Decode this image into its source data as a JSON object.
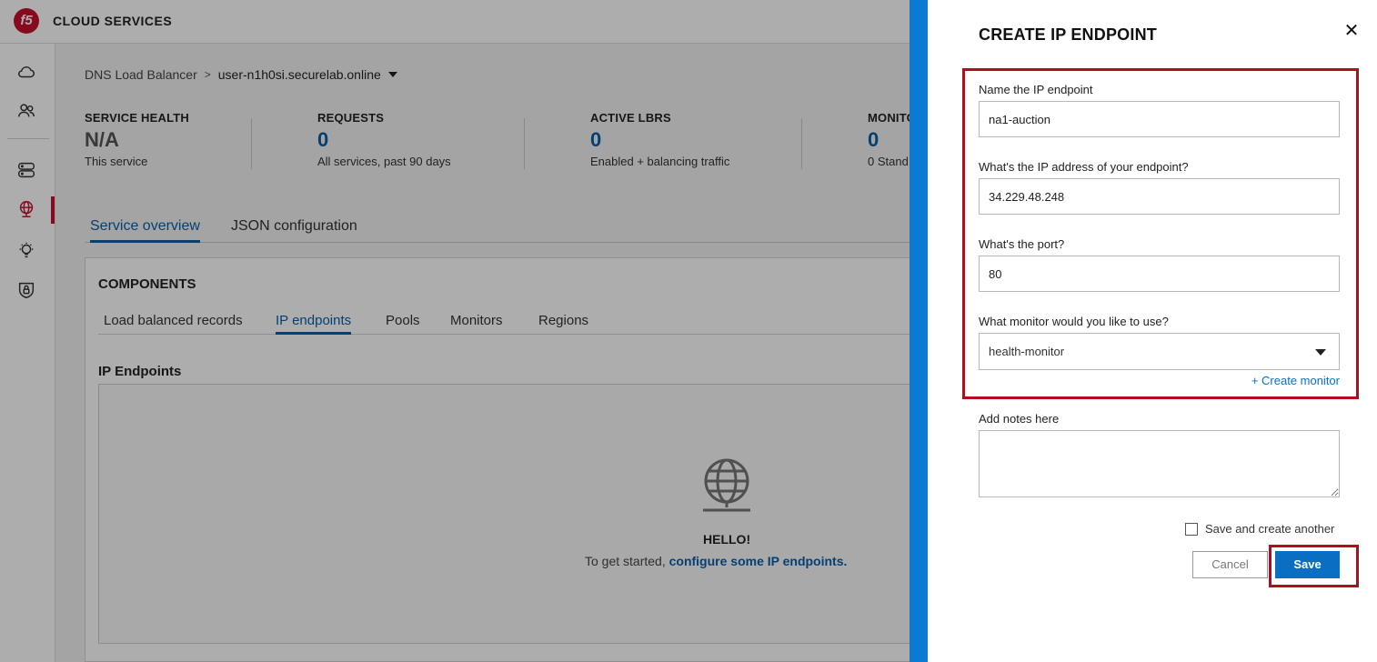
{
  "app": {
    "brand": "CLOUD SERVICES",
    "logo_text": "f5",
    "rail_icons": [
      "cloud-icon",
      "users-icon",
      "server-icon",
      "globe-icon",
      "bulb-icon",
      "shield-lock-icon"
    ]
  },
  "breadcrumb": {
    "root": "DNS Load Balancer",
    "separator": ">",
    "current": "user-n1h0si.securelab.online"
  },
  "stats": [
    {
      "label": "SERVICE HEALTH",
      "value": "N/A",
      "sub": "This service"
    },
    {
      "label": "REQUESTS",
      "value": "0",
      "sub": "All services, past 90 days"
    },
    {
      "label": "ACTIVE LBRS",
      "value": "0",
      "sub": "Enabled + balancing traffic"
    },
    {
      "label": "MONITO",
      "value": "0",
      "sub": "0 Stand"
    }
  ],
  "main_tabs": {
    "service_overview": "Service overview",
    "json_configuration": "JSON configuration"
  },
  "components": {
    "title": "COMPONENTS",
    "tabs": {
      "lb_records": "Load balanced records",
      "ip_endpoints": "IP endpoints",
      "pools": "Pools",
      "monitors": "Monitors",
      "regions": "Regions"
    },
    "section_title": "IP Endpoints",
    "empty_title": "HELLO!",
    "empty_text_prefix": "To get started, ",
    "empty_link": "configure some IP endpoints."
  },
  "drawer": {
    "title": "CREATE IP ENDPOINT",
    "close": "✕",
    "name_label": "Name the IP endpoint",
    "name_value": "na1-auction",
    "ip_label": "What's the IP address of your endpoint?",
    "ip_value": "34.229.48.248",
    "port_label": "What's the port?",
    "port_value": "80",
    "monitor_label": "What monitor would you like to use?",
    "monitor_value": "health-monitor",
    "create_monitor": "+ Create monitor",
    "notes_label": "Add notes here",
    "notes_value": "",
    "save_another_label": "Save and create another",
    "cancel_label": "Cancel",
    "save_label": "Save"
  },
  "colors": {
    "accent": "#0a6fc2",
    "brand_red": "#c8102e",
    "highlight": "#b00e1c",
    "drawer_edge": "#0b7bd1"
  }
}
